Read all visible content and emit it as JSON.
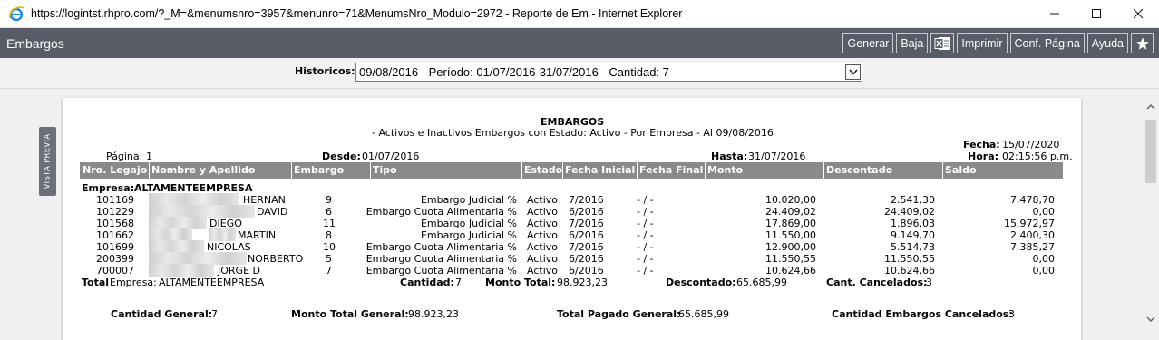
{
  "window": {
    "title": "https://logintst.rhpro.com/?_M=&menumsnro=3957&menunro=71&MenumsNro_Modulo=2972 - Reporte de Em - Internet Explorer",
    "minimize": "—",
    "maximize": "☐",
    "close": "✕"
  },
  "app": {
    "title": "Embargos",
    "toolbar": {
      "generar": "Generar",
      "baja": "Baja",
      "excel_icon": "excel-icon",
      "imprimir": "Imprimir",
      "conf_pagina": "Conf. Página",
      "ayuda": "Ayuda",
      "favorite_icon": "star-icon"
    }
  },
  "filter": {
    "label": "Historicos:",
    "selected": "09/08/2016 - Período: 01/07/2016-31/07/2016 - Cantidad: 7"
  },
  "side_tab": "VISTA PREVIA",
  "report": {
    "title": "EMBARGOS",
    "subtitle": "- Activos e Inactivos Embargos con Estado: Activo - Por Empresa - Al 09/08/2016",
    "pagina_label": "Página:",
    "pagina_value": "1",
    "desde_label": "Desde:",
    "desde_value": "01/07/2016",
    "hasta_label": "Hasta:",
    "hasta_value": "31/07/2016",
    "fecha_label": "Fecha:",
    "fecha_value": "15/07/2020",
    "hora_label": "Hora:",
    "hora_value": "02:15:56 p.m.",
    "columns": [
      "Nro. Legajo",
      "Nombre y Apellido",
      "Embargo",
      "Tipo",
      "Estado",
      "Fecha Inicial",
      "Fecha Final",
      "Monto",
      "Descontado",
      "Saldo"
    ],
    "empresa_label": "Empresa:",
    "empresa_name": "ALTAMENTEEMPRESA",
    "rows": [
      {
        "legajo": "101169",
        "nombre": "HERNAN",
        "embargo": "9",
        "tipo": "Embargo Judicial %",
        "estado": "Activo",
        "fecha_inicial": "7/2016",
        "fecha_final": "- / -",
        "monto": "10.020,00",
        "descontado": "2.541,30",
        "saldo": "7.478,70"
      },
      {
        "legajo": "101229",
        "nombre": "DAVID",
        "embargo": "6",
        "tipo": "Embargo Cuota Alimentaria %",
        "estado": "Activo",
        "fecha_inicial": "6/2016",
        "fecha_final": "- / -",
        "monto": "24.409,02",
        "descontado": "24.409,02",
        "saldo": "0,00"
      },
      {
        "legajo": "101568",
        "nombre": "DIEGO",
        "embargo": "11",
        "tipo": "Embargo Judicial %",
        "estado": "Activo",
        "fecha_inicial": "7/2016",
        "fecha_final": "- / -",
        "monto": "17.869,00",
        "descontado": "1.896,03",
        "saldo": "15.972,97"
      },
      {
        "legajo": "101662",
        "nombre": "MARTIN",
        "embargo": "8",
        "tipo": "Embargo Judicial %",
        "estado": "Activo",
        "fecha_inicial": "6/2016",
        "fecha_final": "- / -",
        "monto": "11.550,00",
        "descontado": "9.149,70",
        "saldo": "2.400,30"
      },
      {
        "legajo": "101699",
        "nombre": "NICOLAS",
        "embargo": "10",
        "tipo": "Embargo Cuota Alimentaria %",
        "estado": "Activo",
        "fecha_inicial": "7/2016",
        "fecha_final": "- / -",
        "monto": "12.900,00",
        "descontado": "5.514,73",
        "saldo": "7.385,27"
      },
      {
        "legajo": "200399",
        "nombre": "NORBERTO",
        "embargo": "5",
        "tipo": "Embargo Cuota Alimentaria %",
        "estado": "Activo",
        "fecha_inicial": "6/2016",
        "fecha_final": "- / -",
        "monto": "11.550,55",
        "descontado": "11.550,55",
        "saldo": "0,00"
      },
      {
        "legajo": "700007",
        "nombre": "JORGE D",
        "embargo": "7",
        "tipo": "Embargo Cuota Alimentaria %",
        "estado": "Activo",
        "fecha_inicial": "6/2016",
        "fecha_final": "- / -",
        "monto": "10.624,66",
        "descontado": "10.624,66",
        "saldo": "0,00"
      }
    ],
    "total": {
      "label": "Total",
      "empresa_label": "Empresa:",
      "empresa_name": "ALTAMENTEEMPRESA",
      "cantidad_label": "Cantidad:",
      "cantidad_value": "7",
      "monto_label": "Monto Total:",
      "monto_value": "98.923,23",
      "descontado_label": "Descontado:",
      "descontado_value": "65.685,99",
      "cancelados_label": "Cant. Cancelados:",
      "cancelados_value": "3"
    },
    "general": {
      "cantidad_label": "Cantidad General:",
      "cantidad_value": "7",
      "monto_label": "Monto Total General:",
      "monto_value": "98.923,23",
      "pagado_label": "Total Pagado General:",
      "pagado_value": "65.685,99",
      "cancelados_label": "Cantidad Embargos Cancelados:",
      "cancelados_value": "3"
    }
  }
}
